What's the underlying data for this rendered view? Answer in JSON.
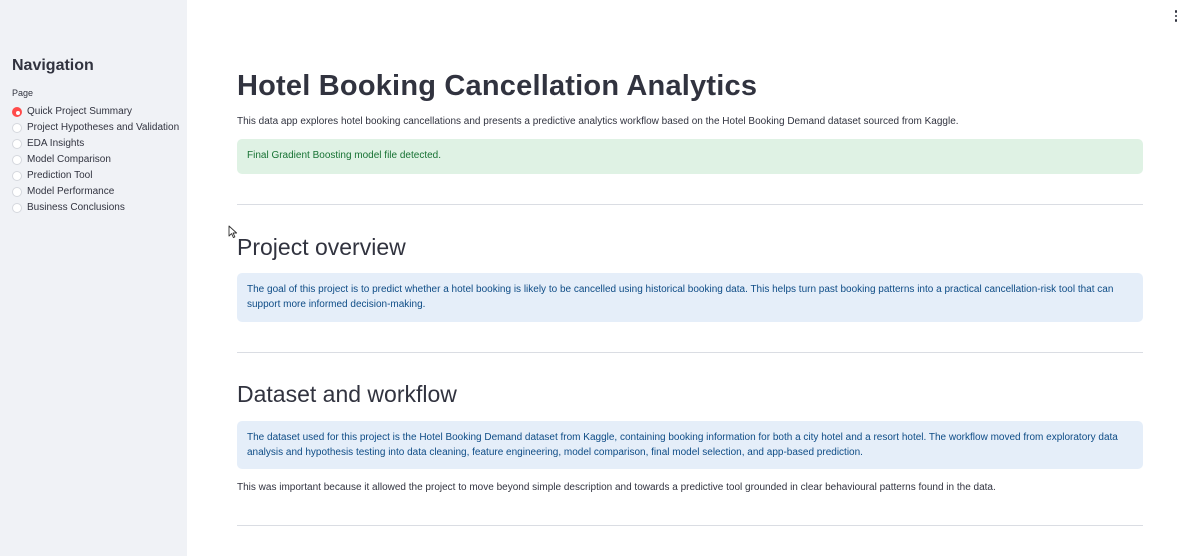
{
  "sidebar": {
    "title": "Navigation",
    "page_label": "Page",
    "items": [
      {
        "label": "Quick Project Summary",
        "selected": true
      },
      {
        "label": "Project Hypotheses and Validation",
        "selected": false
      },
      {
        "label": "EDA Insights",
        "selected": false
      },
      {
        "label": "Model Comparison",
        "selected": false
      },
      {
        "label": "Prediction Tool",
        "selected": false
      },
      {
        "label": "Model Performance",
        "selected": false
      },
      {
        "label": "Business Conclusions",
        "selected": false
      }
    ]
  },
  "main": {
    "title": "Hotel Booking Cancellation Analytics",
    "intro": "This data app explores hotel booking cancellations and presents a predictive analytics workflow based on the Hotel Booking Demand dataset sourced from Kaggle.",
    "success_message": "Final Gradient Boosting model file detected.",
    "overview_heading": "Project overview",
    "overview_text": "The goal of this project is to predict whether a hotel booking is likely to be cancelled using historical booking data. This helps turn past booking patterns into a practical cancellation-risk tool that can support more informed decision-making.",
    "dataset_heading": "Dataset and workflow",
    "dataset_text": "The dataset used for this project is the Hotel Booking Demand dataset from Kaggle, containing booking information for both a city hotel and a resort hotel. The workflow moved from exploratory data analysis and hypothesis testing into data cleaning, feature engineering, model comparison, final model selection, and app-based prediction.",
    "dataset_note": "This was important because it allowed the project to move beyond simple description and towards a predictive tool grounded in clear behavioural patterns found in the data."
  },
  "icons": {
    "menu": "vertical-ellipsis-icon",
    "cursor": "mouse-pointer-icon"
  },
  "colors": {
    "sidebar_bg": "#f0f2f6",
    "radio_selected": "#ff4b4b",
    "success_bg": "#dff2e4",
    "success_text": "#177233",
    "info_bg": "#e5eef9",
    "info_text": "#0e4c86"
  }
}
